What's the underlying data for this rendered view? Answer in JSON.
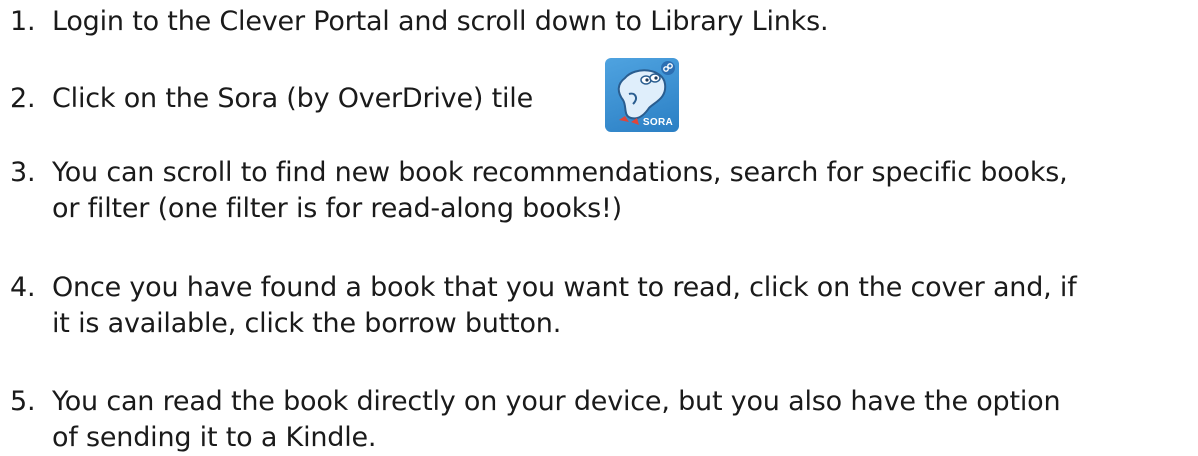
{
  "steps": [
    {
      "number": "1.",
      "line1": "Login to the Clever Portal and scroll down to Library Links.",
      "line2": ""
    },
    {
      "number": "2.",
      "line1": "Click on the Sora (by OverDrive) tile",
      "line2": ""
    },
    {
      "number": "3.",
      "line1": "You can scroll to find new book recommendations, search for specific books,",
      "line2": "or filter (one filter is for read-along books!)"
    },
    {
      "number": "4.",
      "line1": "Once you have found a book that you want to read, click on the cover and, if",
      "line2": "it is available, click the borrow button."
    },
    {
      "number": "5.",
      "line1": "You can read the book directly on your device, but you also have the option",
      "line2": "of sending it to a Kindle."
    }
  ],
  "sora_tile": {
    "icon": "sora-app-icon",
    "label": "SORA",
    "background": "#3a8fd2",
    "accent": "#e0453a"
  }
}
